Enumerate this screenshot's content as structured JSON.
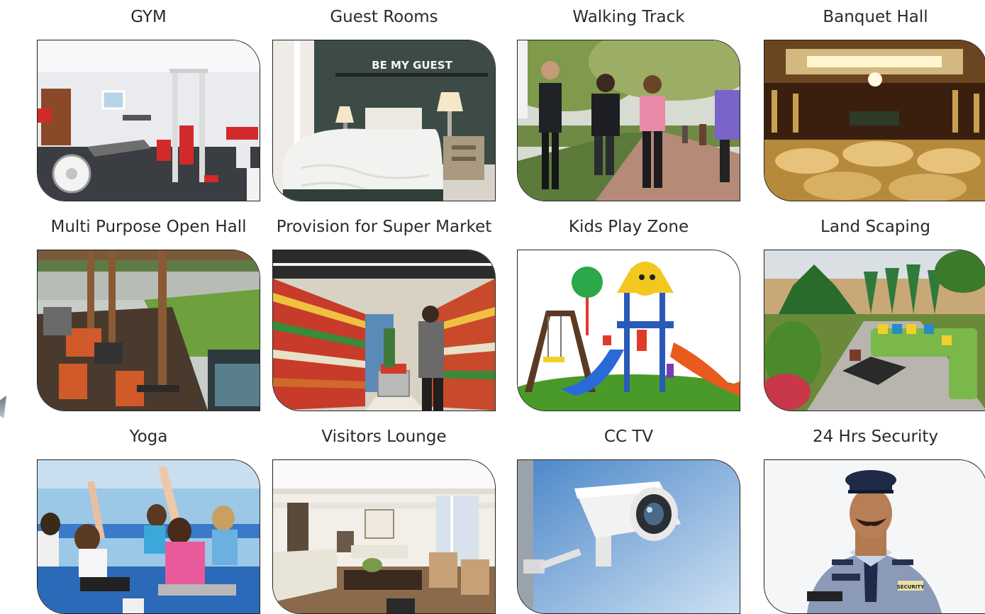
{
  "amenities": [
    {
      "label": "GYM",
      "image": "gym-photo"
    },
    {
      "label": "Guest Rooms",
      "image": "guest-room-photo"
    },
    {
      "label": "Walking Track",
      "image": "walking-track-photo"
    },
    {
      "label": "Banquet Hall",
      "image": "banquet-hall-photo"
    },
    {
      "label": "Multi Purpose Open Hall",
      "image": "open-hall-photo"
    },
    {
      "label": "Provision for Super Market",
      "image": "supermarket-photo"
    },
    {
      "label": "Kids Play Zone",
      "image": "kids-play-zone-photo"
    },
    {
      "label": "Land Scaping",
      "image": "landscaping-photo"
    },
    {
      "label": "Yoga",
      "image": "yoga-photo"
    },
    {
      "label": "Visitors Lounge",
      "image": "visitors-lounge-photo"
    },
    {
      "label": "CC TV",
      "image": "cctv-camera-photo"
    },
    {
      "label": "24 Hrs Security",
      "image": "security-guard-photo"
    }
  ],
  "wall_sign": "BE MY GUEST",
  "guard_badge": "SECURITY"
}
